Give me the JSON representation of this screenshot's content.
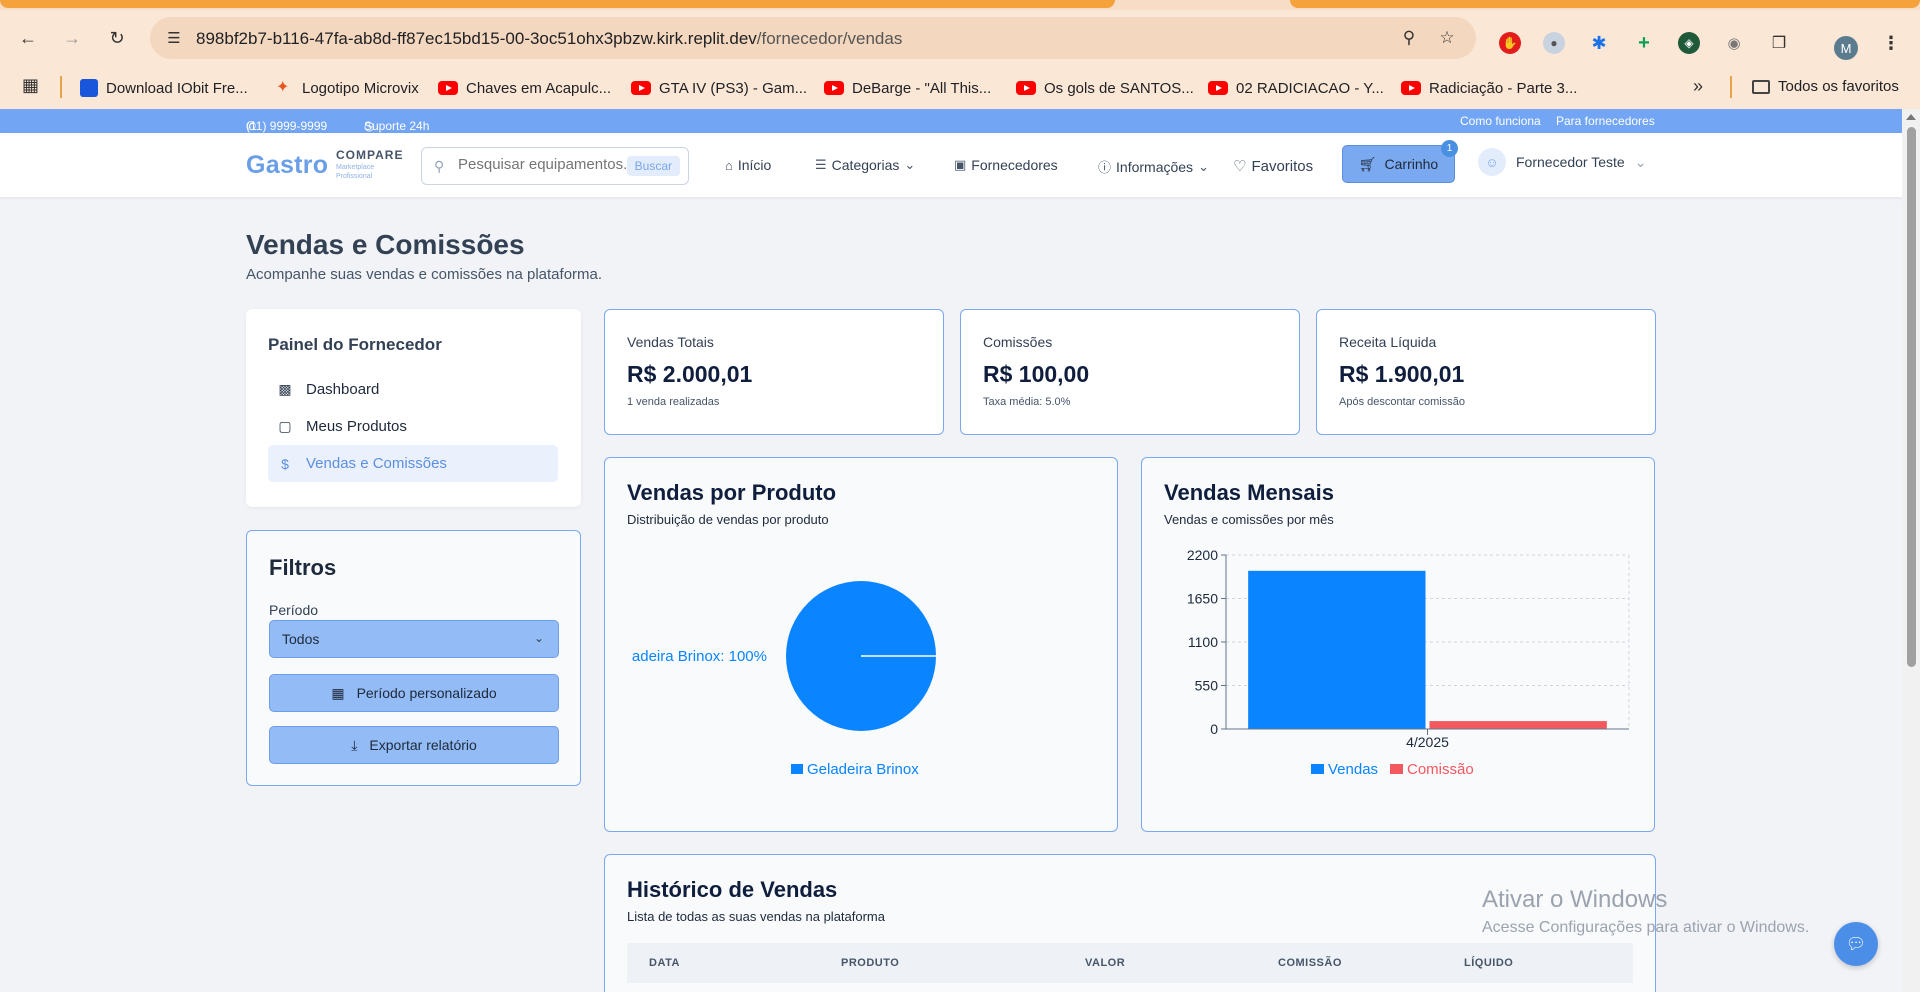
{
  "browser": {
    "url_host": "898bf2b7-b116-47fa-ab8d-ff87ec15bd15-00-3oc51ohx3pbzw.kirk.replit.dev",
    "url_path": "/fornecedor/vendas",
    "profile_initial": "M",
    "bookmarks": [
      {
        "label": "Download IObit Fre...",
        "icon": "iobit-icon"
      },
      {
        "label": "Logotipo Microvix",
        "icon": "microvix-icon"
      },
      {
        "label": "Chaves em Acapulc...",
        "icon": "youtube-icon"
      },
      {
        "label": "GTA IV (PS3) - Gam...",
        "icon": "youtube-icon"
      },
      {
        "label": "DeBarge - \"All This...",
        "icon": "youtube-icon"
      },
      {
        "label": "Os gols de SANTOS...",
        "icon": "youtube-icon"
      },
      {
        "label": "02 RADICIACAO - Y...",
        "icon": "youtube-icon"
      },
      {
        "label": "Radiciação - Parte 3...",
        "icon": "youtube-icon"
      }
    ],
    "all_bookmarks_label": "Todos os favoritos"
  },
  "topbar": {
    "phone": "(11) 9999-9999",
    "support": "Suporte 24h",
    "how_it_works": "Como funciona",
    "for_suppliers": "Para fornecedores"
  },
  "header": {
    "logo_word": "Gastro",
    "logo_compare": "COMPARE",
    "logo_sub1": "Marketplace",
    "logo_sub2": "Profissional",
    "search_placeholder": "Pesquisar equipamentos...",
    "search_button": "Buscar",
    "nav": {
      "home": "Início",
      "categories": "Categorias",
      "suppliers": "Fornecedores",
      "info": "Informações",
      "favorites": "Favoritos"
    },
    "cart_label": "Carrinho",
    "cart_count": "1",
    "user_name": "Fornecedor Teste"
  },
  "page": {
    "title": "Vendas e Comissões",
    "subtitle": "Acompanhe suas vendas e comissões na plataforma."
  },
  "sidebar": {
    "title": "Painel do Fornecedor",
    "items": [
      {
        "label": "Dashboard",
        "icon": "bar-chart-icon"
      },
      {
        "label": "Meus Produtos",
        "icon": "package-icon"
      },
      {
        "label": "Vendas e Comissões",
        "icon": "dollar-icon"
      }
    ]
  },
  "filters": {
    "title": "Filtros",
    "period_label": "Período",
    "period_value": "Todos",
    "custom_period": "Período personalizado",
    "export": "Exportar relatório"
  },
  "stats": [
    {
      "title": "Vendas Totais",
      "value": "R$ 2.000,01",
      "note": "1 venda realizadas"
    },
    {
      "title": "Comissões",
      "value": "R$ 100,00",
      "note": "Taxa média: 5.0%"
    },
    {
      "title": "Receita Líquida",
      "value": "R$ 1.900,01",
      "note": "Após descontar comissão"
    }
  ],
  "charts": {
    "by_product": {
      "title": "Vendas por Produto",
      "description": "Distribuição de vendas por produto",
      "slice_label": "adeira Brinox: 100%",
      "legend": "Geladeira Brinox"
    },
    "monthly": {
      "title": "Vendas Mensais",
      "description": "Vendas e comissões por mês",
      "legend_sales": "Vendas",
      "legend_commission": "Comissão"
    }
  },
  "chart_data": [
    {
      "type": "pie",
      "title": "Vendas por Produto",
      "categories": [
        "Geladeira Brinox"
      ],
      "values": [
        100
      ],
      "colors": [
        "#0a84ff"
      ]
    },
    {
      "type": "bar",
      "title": "Vendas Mensais",
      "categories": [
        "4/2025"
      ],
      "series": [
        {
          "name": "Vendas",
          "values": [
            2000.01
          ],
          "color": "#0a84ff"
        },
        {
          "name": "Comissão",
          "values": [
            100
          ],
          "color": "#f4585f"
        }
      ],
      "yticks": [
        0,
        550,
        1100,
        1650,
        2200
      ],
      "ylim": [
        0,
        2200
      ],
      "grid": true,
      "legend": "bottom"
    }
  ],
  "history": {
    "title": "Histórico de Vendas",
    "description": "Lista de todas as suas vendas na plataforma",
    "columns": [
      "DATA",
      "PRODUTO",
      "VALOR",
      "COMISSÃO",
      "LÍQUIDO"
    ]
  },
  "watermark": {
    "line1": "Ativar o Windows",
    "line2": "Acesse Configurações para ativar o Windows."
  },
  "colors": {
    "accent": "#7aa9f0",
    "sales": "#0a84ff",
    "commission": "#f4585f"
  }
}
